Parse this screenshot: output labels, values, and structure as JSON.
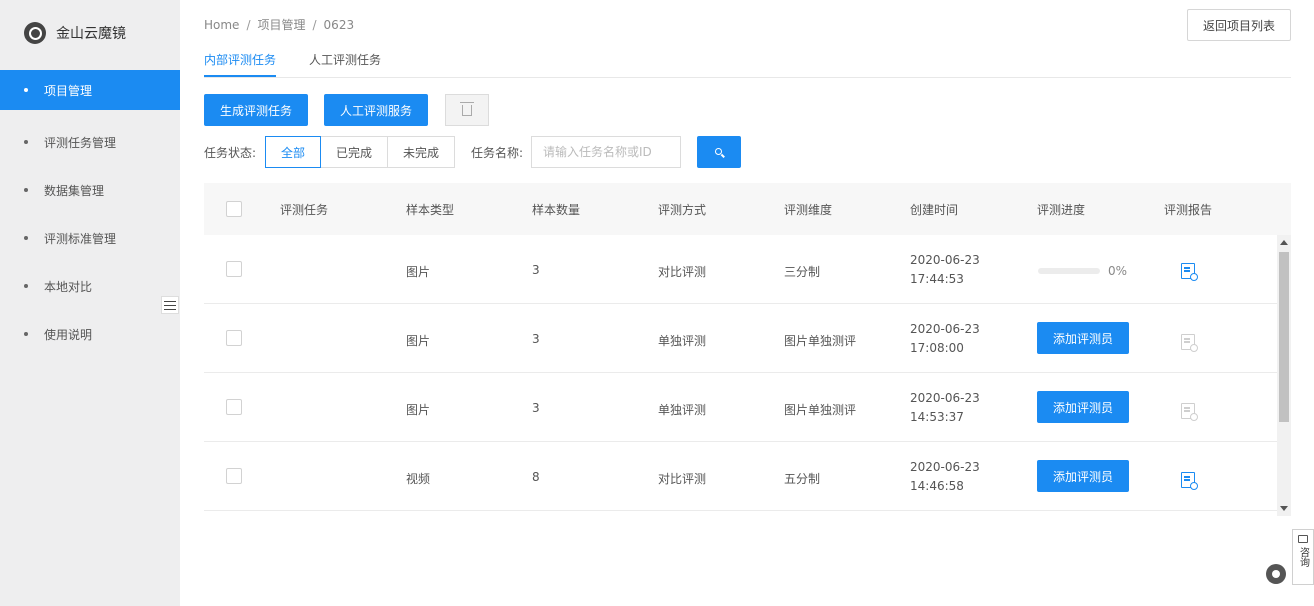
{
  "app": {
    "name": "金山云魔镜"
  },
  "sidebar": {
    "items": [
      {
        "label": "项目管理",
        "active": true
      },
      {
        "label": "评测任务管理"
      },
      {
        "label": "数据集管理"
      },
      {
        "label": "评测标准管理"
      },
      {
        "label": "本地对比"
      },
      {
        "label": "使用说明"
      }
    ]
  },
  "breadcrumb": [
    "Home",
    "项目管理",
    "0623"
  ],
  "back_button": "返回项目列表",
  "tabs": [
    {
      "label": "内部评测任务",
      "active": true
    },
    {
      "label": "人工评测任务"
    }
  ],
  "toolbar": {
    "generate_label": "生成评测任务",
    "manual_label": "人工评测服务",
    "delete_icon": "trash-icon"
  },
  "filters": {
    "status_label": "任务状态:",
    "status_options": [
      "全部",
      "已完成",
      "未完成"
    ],
    "status_selected": "全部",
    "name_label": "任务名称:",
    "name_placeholder": "请输入任务名称或ID",
    "name_value": ""
  },
  "table": {
    "columns": [
      "评测任务",
      "样本类型",
      "样本数量",
      "评测方式",
      "评测维度",
      "创建时间",
      "评测进度",
      "评测报告"
    ],
    "rows": [
      {
        "task": "",
        "sample_type": "图片",
        "sample_count": "3",
        "method": "对比评测",
        "dimension": "三分制",
        "date": "2020-06-23",
        "time": "17:44:53",
        "progress_value": 0,
        "progress_text": "0%",
        "report_enabled": true
      },
      {
        "task": "",
        "sample_type": "图片",
        "sample_count": "3",
        "method": "单独评测",
        "dimension": "图片单独测评",
        "date": "2020-06-23",
        "time": "17:08:00",
        "action": "添加评测员",
        "report_enabled": false
      },
      {
        "task": "",
        "sample_type": "图片",
        "sample_count": "3",
        "method": "单独评测",
        "dimension": "图片单独测评",
        "date": "2020-06-23",
        "time": "14:53:37",
        "action": "添加评测员",
        "report_enabled": false
      },
      {
        "task": "",
        "sample_type": "视频",
        "sample_count": "8",
        "method": "对比评测",
        "dimension": "五分制",
        "date": "2020-06-23",
        "time": "14:46:58",
        "action": "添加评测员",
        "report_enabled": true
      }
    ]
  },
  "consult": {
    "label": "咨询"
  },
  "colors": {
    "accent": "#1b8bf2",
    "sidebar_bg": "#eeeeef"
  }
}
